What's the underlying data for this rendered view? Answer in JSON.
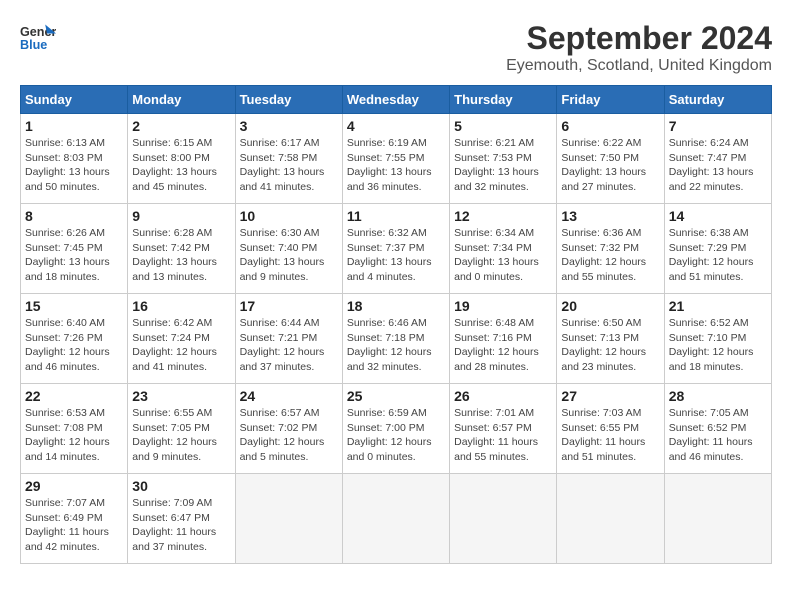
{
  "header": {
    "logo_line1": "General",
    "logo_line2": "Blue",
    "title": "September 2024",
    "subtitle": "Eyemouth, Scotland, United Kingdom"
  },
  "calendar": {
    "days_of_week": [
      "Sunday",
      "Monday",
      "Tuesday",
      "Wednesday",
      "Thursday",
      "Friday",
      "Saturday"
    ],
    "weeks": [
      [
        {
          "day": "1",
          "info": "Sunrise: 6:13 AM\nSunset: 8:03 PM\nDaylight: 13 hours\nand 50 minutes."
        },
        {
          "day": "2",
          "info": "Sunrise: 6:15 AM\nSunset: 8:00 PM\nDaylight: 13 hours\nand 45 minutes."
        },
        {
          "day": "3",
          "info": "Sunrise: 6:17 AM\nSunset: 7:58 PM\nDaylight: 13 hours\nand 41 minutes."
        },
        {
          "day": "4",
          "info": "Sunrise: 6:19 AM\nSunset: 7:55 PM\nDaylight: 13 hours\nand 36 minutes."
        },
        {
          "day": "5",
          "info": "Sunrise: 6:21 AM\nSunset: 7:53 PM\nDaylight: 13 hours\nand 32 minutes."
        },
        {
          "day": "6",
          "info": "Sunrise: 6:22 AM\nSunset: 7:50 PM\nDaylight: 13 hours\nand 27 minutes."
        },
        {
          "day": "7",
          "info": "Sunrise: 6:24 AM\nSunset: 7:47 PM\nDaylight: 13 hours\nand 22 minutes."
        }
      ],
      [
        {
          "day": "8",
          "info": "Sunrise: 6:26 AM\nSunset: 7:45 PM\nDaylight: 13 hours\nand 18 minutes."
        },
        {
          "day": "9",
          "info": "Sunrise: 6:28 AM\nSunset: 7:42 PM\nDaylight: 13 hours\nand 13 minutes."
        },
        {
          "day": "10",
          "info": "Sunrise: 6:30 AM\nSunset: 7:40 PM\nDaylight: 13 hours\nand 9 minutes."
        },
        {
          "day": "11",
          "info": "Sunrise: 6:32 AM\nSunset: 7:37 PM\nDaylight: 13 hours\nand 4 minutes."
        },
        {
          "day": "12",
          "info": "Sunrise: 6:34 AM\nSunset: 7:34 PM\nDaylight: 13 hours\nand 0 minutes."
        },
        {
          "day": "13",
          "info": "Sunrise: 6:36 AM\nSunset: 7:32 PM\nDaylight: 12 hours\nand 55 minutes."
        },
        {
          "day": "14",
          "info": "Sunrise: 6:38 AM\nSunset: 7:29 PM\nDaylight: 12 hours\nand 51 minutes."
        }
      ],
      [
        {
          "day": "15",
          "info": "Sunrise: 6:40 AM\nSunset: 7:26 PM\nDaylight: 12 hours\nand 46 minutes."
        },
        {
          "day": "16",
          "info": "Sunrise: 6:42 AM\nSunset: 7:24 PM\nDaylight: 12 hours\nand 41 minutes."
        },
        {
          "day": "17",
          "info": "Sunrise: 6:44 AM\nSunset: 7:21 PM\nDaylight: 12 hours\nand 37 minutes."
        },
        {
          "day": "18",
          "info": "Sunrise: 6:46 AM\nSunset: 7:18 PM\nDaylight: 12 hours\nand 32 minutes."
        },
        {
          "day": "19",
          "info": "Sunrise: 6:48 AM\nSunset: 7:16 PM\nDaylight: 12 hours\nand 28 minutes."
        },
        {
          "day": "20",
          "info": "Sunrise: 6:50 AM\nSunset: 7:13 PM\nDaylight: 12 hours\nand 23 minutes."
        },
        {
          "day": "21",
          "info": "Sunrise: 6:52 AM\nSunset: 7:10 PM\nDaylight: 12 hours\nand 18 minutes."
        }
      ],
      [
        {
          "day": "22",
          "info": "Sunrise: 6:53 AM\nSunset: 7:08 PM\nDaylight: 12 hours\nand 14 minutes."
        },
        {
          "day": "23",
          "info": "Sunrise: 6:55 AM\nSunset: 7:05 PM\nDaylight: 12 hours\nand 9 minutes."
        },
        {
          "day": "24",
          "info": "Sunrise: 6:57 AM\nSunset: 7:02 PM\nDaylight: 12 hours\nand 5 minutes."
        },
        {
          "day": "25",
          "info": "Sunrise: 6:59 AM\nSunset: 7:00 PM\nDaylight: 12 hours\nand 0 minutes."
        },
        {
          "day": "26",
          "info": "Sunrise: 7:01 AM\nSunset: 6:57 PM\nDaylight: 11 hours\nand 55 minutes."
        },
        {
          "day": "27",
          "info": "Sunrise: 7:03 AM\nSunset: 6:55 PM\nDaylight: 11 hours\nand 51 minutes."
        },
        {
          "day": "28",
          "info": "Sunrise: 7:05 AM\nSunset: 6:52 PM\nDaylight: 11 hours\nand 46 minutes."
        }
      ],
      [
        {
          "day": "29",
          "info": "Sunrise: 7:07 AM\nSunset: 6:49 PM\nDaylight: 11 hours\nand 42 minutes."
        },
        {
          "day": "30",
          "info": "Sunrise: 7:09 AM\nSunset: 6:47 PM\nDaylight: 11 hours\nand 37 minutes."
        },
        {
          "day": "",
          "info": ""
        },
        {
          "day": "",
          "info": ""
        },
        {
          "day": "",
          "info": ""
        },
        {
          "day": "",
          "info": ""
        },
        {
          "day": "",
          "info": ""
        }
      ]
    ]
  }
}
